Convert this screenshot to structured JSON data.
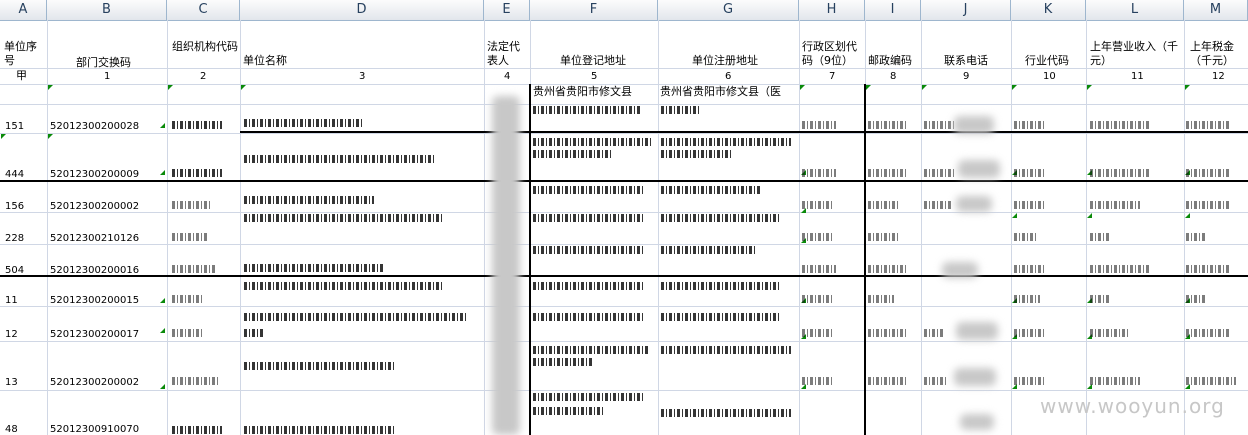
{
  "columns": [
    "A",
    "B",
    "C",
    "D",
    "E",
    "F",
    "G",
    "H",
    "I",
    "J",
    "K",
    "L",
    "M"
  ],
  "headers": {
    "unit_seq": "单位序号",
    "dept_code": "部门交换码",
    "org_code": "组织机构代码",
    "unit_name": "单位名称",
    "legal_rep": "法定代表人",
    "reg_address": "单位登记地址",
    "registered_address": "单位注册地址",
    "admin_code": "行政区划代码（9位）",
    "postcode": "邮政编码",
    "phone": "联系电话",
    "industry": "行业代码",
    "revenue": "上年营业收入（千元）",
    "tax": "上年税金（千元）"
  },
  "index_row": {
    "marker": "甲",
    "numbers": [
      "1",
      "2",
      "3",
      "4",
      "5",
      "6",
      "7",
      "8",
      "9",
      "10",
      "11",
      "12"
    ]
  },
  "top_row": {
    "reg_address": "贵州省贵阳市修文县",
    "registered_address": "贵州省贵阳市修文县（医"
  },
  "rows": [
    {
      "seq": "151",
      "code": "52012300200028"
    },
    {
      "seq": "444",
      "code": "52012300200009"
    },
    {
      "seq": "156",
      "code": "52012300200002"
    },
    {
      "seq": "228",
      "code": "52012300210126"
    },
    {
      "seq": "504",
      "code": "52012300200016"
    },
    {
      "seq": "11",
      "code": "52012300200015"
    },
    {
      "seq": "12",
      "code": "52012300200017"
    },
    {
      "seq": "13",
      "code": "52012300200002"
    },
    {
      "seq": "48",
      "code": "52012300910070"
    }
  ],
  "watermark": "www.wooyun.org"
}
